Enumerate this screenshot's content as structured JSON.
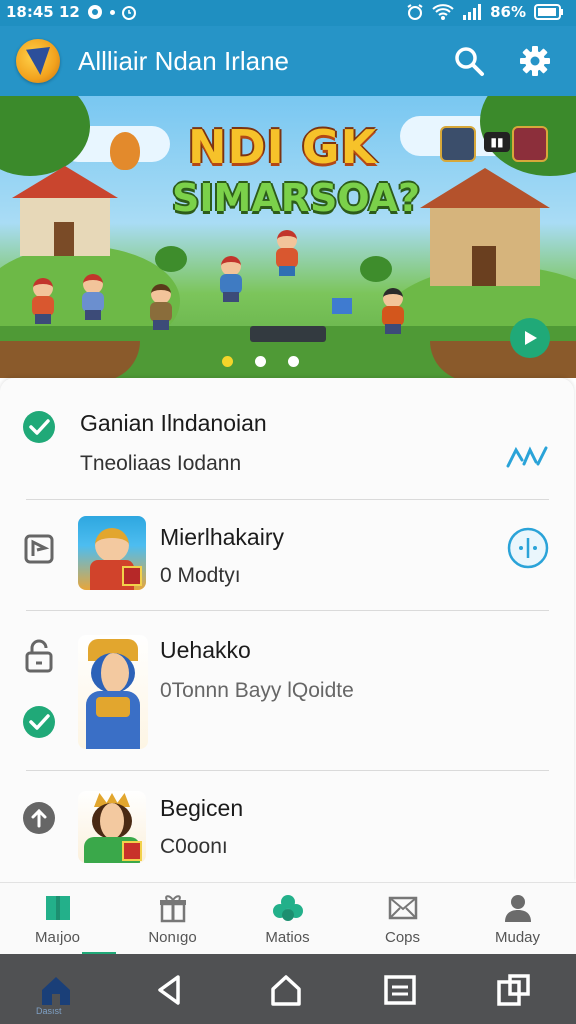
{
  "status_bar": {
    "time": "18:45 12",
    "battery": "86%"
  },
  "app_bar": {
    "title": "Allliair Ndan Irlane",
    "search_icon": "search-icon",
    "settings_icon": "gear-icon"
  },
  "hero": {
    "title": "NDI GK",
    "subtitle": "SIMARSOA?",
    "slide_count": 3,
    "active_slide": 1
  },
  "list": {
    "items": [
      {
        "title": "Ganian Ilndanoian",
        "subtitle": "Tneoliaas Iodann",
        "left_icon": "check-circle-icon",
        "right_icon": "tools-icon"
      },
      {
        "title": "Mierlhakairy",
        "subtitle": "0 Modtyı",
        "left_icon": "flag-icon",
        "right_icon": "info-circle-icon"
      },
      {
        "title": "Uehakko",
        "subtitle": "0Tonnn Bayy lQoidte",
        "left_icon": "lock-icon",
        "right_icon": ""
      },
      {
        "title": "Begicen",
        "subtitle": "C0oonı",
        "left_icon": "arrow-up-circle-icon",
        "right_icon": ""
      }
    ]
  },
  "bottom_nav": {
    "items": [
      {
        "label": "Maıjoo",
        "icon": "home-tab-icon"
      },
      {
        "label": "Nonıgo",
        "icon": "gift-icon"
      },
      {
        "label": "Matios",
        "icon": "group-icon"
      },
      {
        "label": "Cops",
        "icon": "mail-icon"
      },
      {
        "label": "Muday",
        "icon": "person-icon"
      }
    ],
    "active_index": 0
  },
  "system_nav": {
    "home_label": "Dasıst"
  },
  "colors": {
    "primary": "#2694c7",
    "accent": "#20a978",
    "status_bar": "#1f8fc1"
  }
}
